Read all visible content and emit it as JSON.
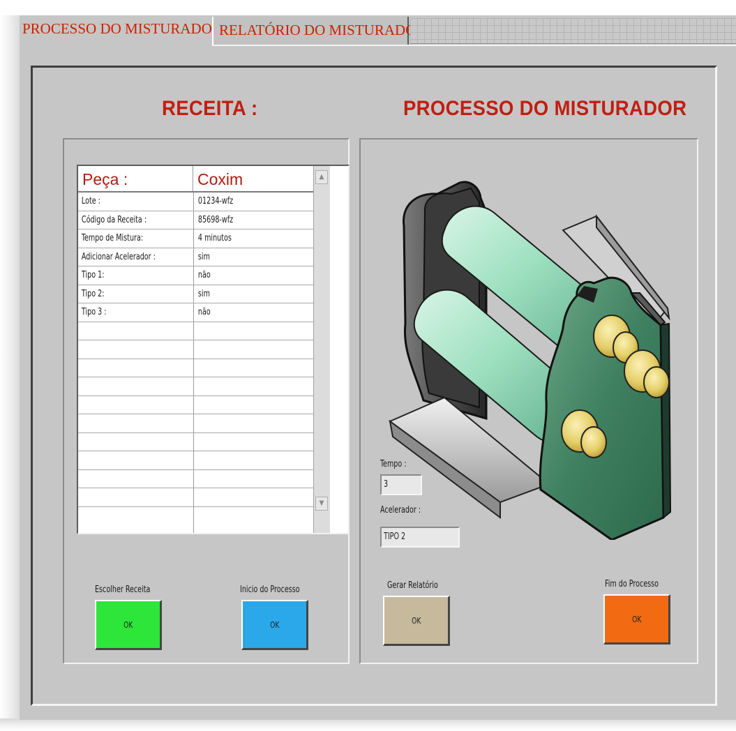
{
  "tabs": [
    {
      "label": "PROCESSO DO MISTURADOR",
      "active": true
    },
    {
      "label": "RELATÓRIO DO MISTURADOR",
      "active": false
    }
  ],
  "recipe": {
    "heading": "RECEITA :",
    "table": {
      "header": {
        "label": "Peça :",
        "value": "Coxim"
      },
      "rows": [
        {
          "label": "Lote :",
          "value": "01234-wfz"
        },
        {
          "label": "Código da Receita :",
          "value": "85698-wfz"
        },
        {
          "label": "Tempo de Mistura:",
          "value": "4 minutos"
        },
        {
          "label": "Adicionar Acelerador :",
          "value": "sim"
        },
        {
          "label": "Tipo 1:",
          "value": "não"
        },
        {
          "label": "Tipo 2:",
          "value": "sim"
        },
        {
          "label": "Tipo 3 :",
          "value": "não"
        }
      ]
    },
    "buttons": [
      {
        "caption": "Escolher Receita",
        "text": "OK",
        "color": "#2ee63a"
      },
      {
        "caption": "Inicio do Processo",
        "text": "OK",
        "color": "#2aa8ea"
      }
    ]
  },
  "process": {
    "heading": "PROCESSO DO MISTURADOR",
    "tempo": {
      "label": "Tempo :",
      "value": "3"
    },
    "acelerador": {
      "label": "Acelerador :",
      "value": "TIPO 2"
    },
    "buttons": [
      {
        "caption": "Gerar Relatório",
        "text": "OK",
        "color": "#c6b99c"
      },
      {
        "caption": "Fim do Processo",
        "text": "OK",
        "color": "#f26a12"
      }
    ]
  },
  "colors": {
    "heading_red": "#c01f12",
    "tab_red": "#cc2200",
    "panel_gray": "#c6c6c6",
    "roller_green": "#9ee0c0",
    "plate_green": "#3f8060"
  }
}
